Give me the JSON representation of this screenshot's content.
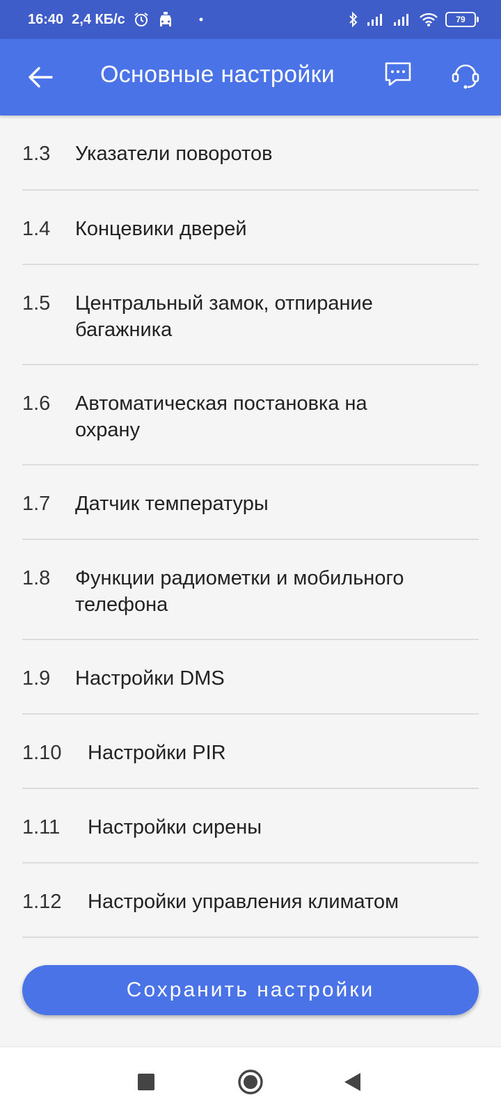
{
  "status_bar": {
    "time": "16:40",
    "speed": "2,4 КБ/с",
    "battery": "79",
    "icons": [
      "alarm-icon",
      "car-icon",
      "dot-icon",
      "bluetooth-icon",
      "signal-icon",
      "signal-icon",
      "wifi-icon",
      "battery-icon"
    ]
  },
  "app_bar": {
    "title": "Основные настройки",
    "icons": [
      "back-arrow-icon",
      "chat-icon",
      "support-headset-icon"
    ]
  },
  "settings": {
    "items": [
      {
        "number": "1.3",
        "label": "Указатели поворотов"
      },
      {
        "number": "1.4",
        "label": "Концевики дверей"
      },
      {
        "number": "1.5",
        "label": "Центральный замок, отпирание багажника"
      },
      {
        "number": "1.6",
        "label": "Автоматическая постановка на охрану"
      },
      {
        "number": "1.7",
        "label": "Датчик температуры"
      },
      {
        "number": "1.8",
        "label": "Функции радиометки и мобильного телефона"
      },
      {
        "number": "1.9",
        "label": "Настройки DMS"
      },
      {
        "number": "1.10",
        "label": "Настройки PIR"
      },
      {
        "number": "1.11",
        "label": "Настройки сирены"
      },
      {
        "number": "1.12",
        "label": "Настройки управления климатом"
      }
    ]
  },
  "save_button": {
    "label": "Сохранить настройки"
  },
  "nav_bar": {
    "icons": [
      "recents-square-icon",
      "home-circle-icon",
      "back-triangle-icon"
    ]
  },
  "colors": {
    "status_bar": "#3f5dc8",
    "accent": "#4a73e8",
    "background": "#f5f5f5",
    "divider": "#dcdcdc"
  }
}
